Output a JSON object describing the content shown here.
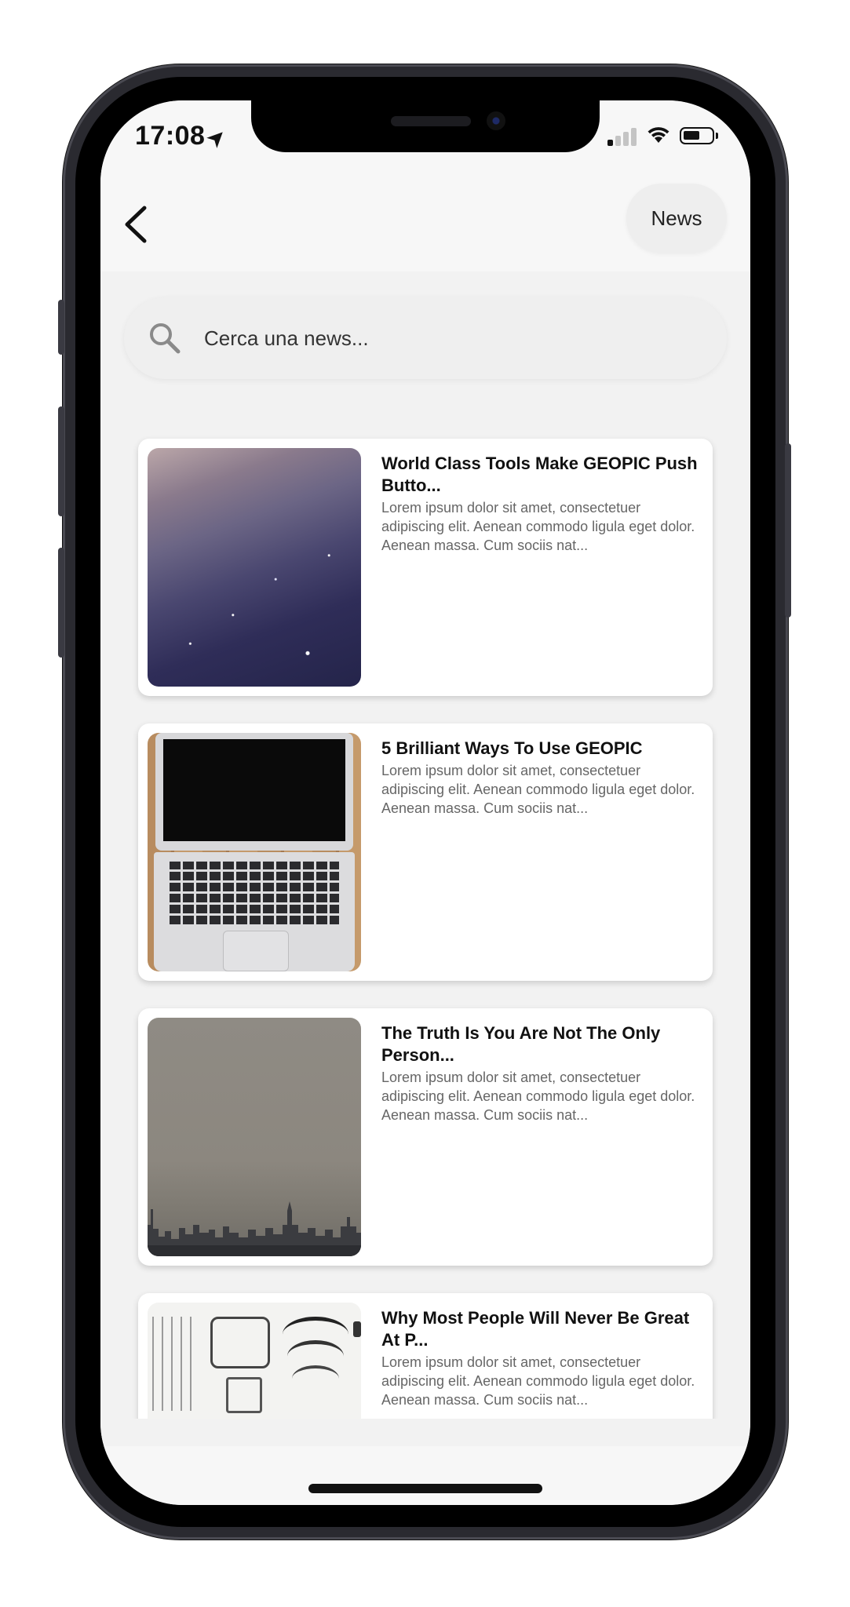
{
  "status_bar": {
    "time": "17:08",
    "location_arrow": "➤",
    "signal_icon": "cellular-signal-icon",
    "wifi_icon": "wifi-icon",
    "battery_icon": "battery-icon"
  },
  "header": {
    "back_icon": "chevron-left-icon",
    "news_button_label": "News"
  },
  "search": {
    "placeholder": "Cerca una news...",
    "icon": "search-icon"
  },
  "news": [
    {
      "title": "World Class Tools Make GEOPIC Push Butto...",
      "description": "Lorem ipsum dolor sit amet, consectetuer adipiscing elit. Aenean commodo ligula eget dolor. Aenean massa. Cum sociis nat...",
      "image": "night-sky-stars-image"
    },
    {
      "title": "5 Brilliant Ways To Use GEOPIC",
      "description": "Lorem ipsum dolor sit amet, consectetuer adipiscing elit. Aenean commodo ligula eget dolor. Aenean massa. Cum sociis nat...",
      "image": "laptop-on-desk-image"
    },
    {
      "title": "The Truth Is You Are Not The Only Person...",
      "description": "Lorem ipsum dolor sit amet, consectetuer adipiscing elit. Aenean commodo ligula eget dolor. Aenean massa. Cum sociis nat...",
      "image": "city-skyline-image"
    },
    {
      "title": "Why Most People Will Never Be Great At P...",
      "description": "Lorem ipsum dolor sit amet, consectetuer adipiscing elit. Aenean commodo ligula eget dolor. Aenean massa. Cum sociis nat...",
      "image": "disassembled-typewriter-image"
    }
  ],
  "colors": {
    "screen_background": "#f2f2f2",
    "card_background": "#ffffff",
    "title_text": "#111111",
    "body_text": "#666666"
  }
}
